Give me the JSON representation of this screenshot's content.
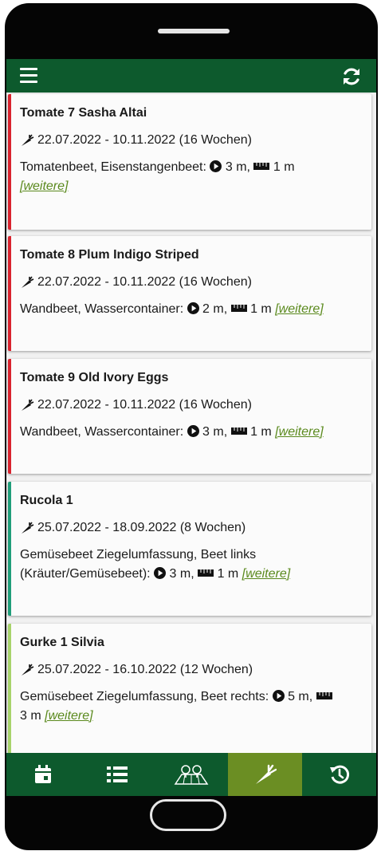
{
  "app": {
    "topbar": {
      "menu_icon": "hamburger-menu-icon",
      "sync_icon": "sync-icon"
    }
  },
  "colors": {
    "brand_green": "#0d5a2d",
    "active_nav": "#6b8e23",
    "tomato_red": "#d9232e",
    "rucola_teal": "#1f9e7a",
    "gurke_lightgreen": "#a7d36a",
    "link_green": "#5b8a1e"
  },
  "cards": [
    {
      "title": "Tomate 7 Sasha Altai",
      "dates": "22.07.2022 - 10.11.2022 (16 Wochen)",
      "location_line1": "Tomatenbeet, Eisenstangenbeet:",
      "location_line2": "",
      "distance_row": "3 m,",
      "distance_plant": "1 m",
      "more": "[weitere]"
    },
    {
      "title": "Tomate 8 Plum Indigo Striped",
      "dates": "22.07.2022 - 10.11.2022 (16 Wochen)",
      "location_line1": "Wandbeet, Wassercontainer:",
      "location_line2": "",
      "distance_row": "2 m,",
      "distance_plant": "1 m",
      "more": "[weitere]"
    },
    {
      "title": "Tomate 9 Old Ivory Eggs",
      "dates": "22.07.2022 - 10.11.2022 (16 Wochen)",
      "location_line1": "Wandbeet, Wassercontainer:",
      "location_line2": "",
      "distance_row": "3 m,",
      "distance_plant": "1 m",
      "more": "[weitere]"
    },
    {
      "title": "Rucola 1",
      "dates": "25.07.2022 - 18.09.2022 (8 Wochen)",
      "location_line1": "Gemüsebeet Ziegelumfassung, Beet links",
      "location_line2": "(Kräuter/Gemüsebeet):",
      "distance_row": "3 m,",
      "distance_plant": "1 m",
      "more": "[weitere]"
    },
    {
      "title": "Gurke 1 Silvia",
      "dates": "25.07.2022 - 16.10.2022 (12 Wochen)",
      "location_line1": "Gemüsebeet Ziegelumfassung, Beet rechts:",
      "location_line2": "",
      "distance_row": "5 m,",
      "distance_plant": "3 m",
      "more": "[weitere]"
    }
  ],
  "bottom_nav": [
    {
      "icon": "calendar-icon",
      "active": false
    },
    {
      "icon": "list-icon",
      "active": false
    },
    {
      "icon": "map-icon",
      "active": false
    },
    {
      "icon": "carrot-icon",
      "active": true
    },
    {
      "icon": "history-icon",
      "active": false
    }
  ]
}
